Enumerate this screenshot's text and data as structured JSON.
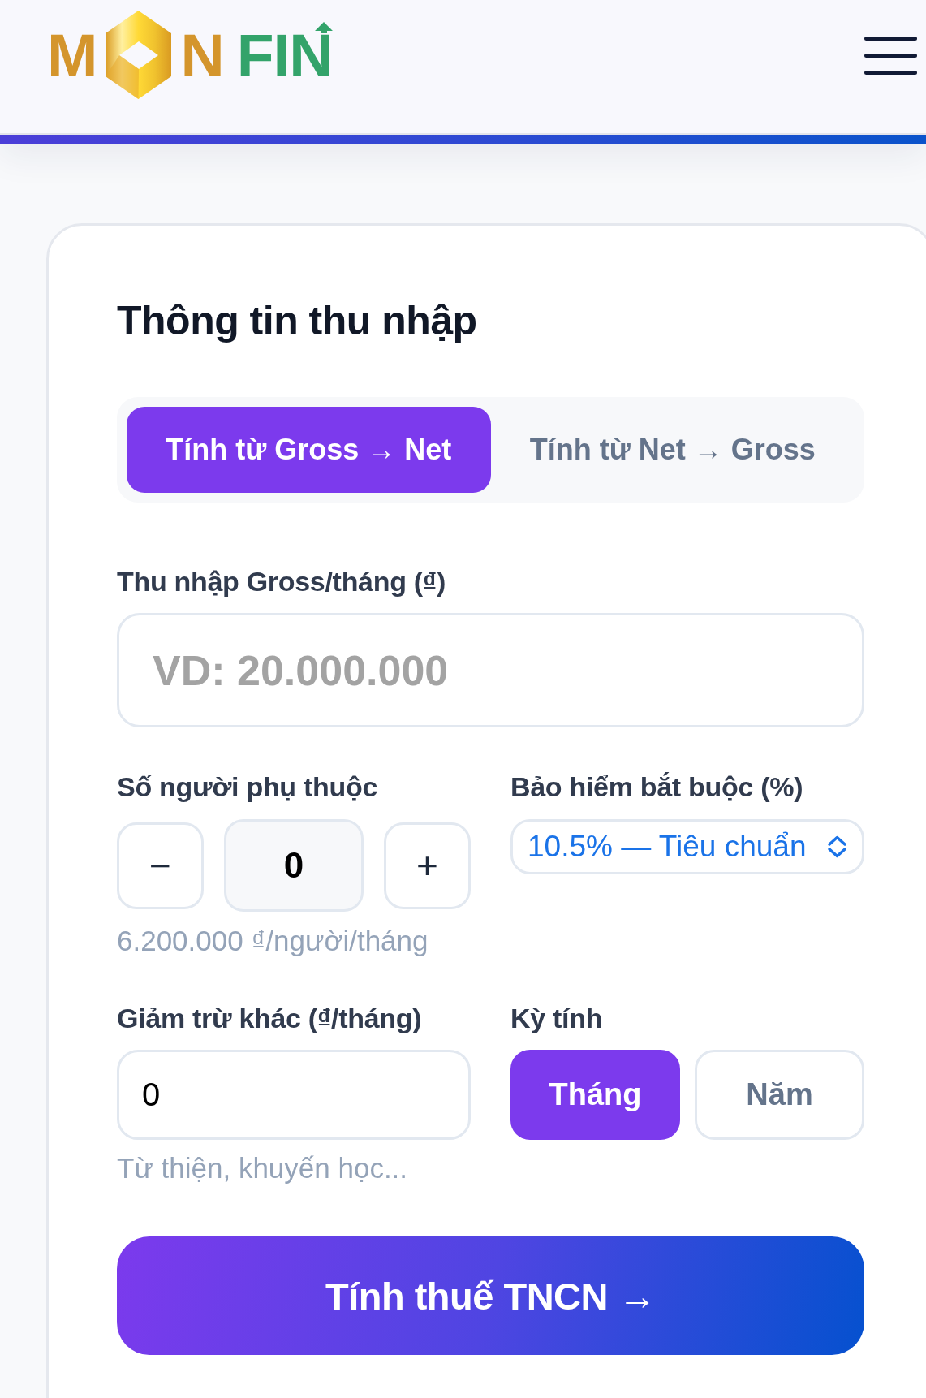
{
  "header": {
    "logo": {
      "text_before_icon": "M",
      "text_after_icon": "N",
      "accent_text": "FIN"
    }
  },
  "card": {
    "title": "Thông tin thu nhập",
    "mode_tabs": [
      {
        "label": "Tính từ Gross → Net",
        "selected": true
      },
      {
        "label": "Tính từ Net → Gross",
        "selected": false
      }
    ],
    "gross_income": {
      "label": "Thu nhập Gross/tháng (₫)",
      "placeholder": "VD: 20.000.000"
    },
    "dependents": {
      "label": "Số người phụ thuộc",
      "decrement": "−",
      "value": "0",
      "increment": "+",
      "hint": "6.200.000 ₫/người/tháng"
    },
    "insurance": {
      "label": "Bảo hiểm bắt buộc (%)",
      "value": "10.5% — Tiêu chuẩn"
    },
    "other_deductions": {
      "label": "Giảm trừ khác (₫/tháng)",
      "value": "0",
      "hint": "Từ thiện, khuyến học..."
    },
    "period": {
      "label": "Kỳ tính",
      "options": [
        {
          "label": "Tháng",
          "selected": true
        },
        {
          "label": "Năm",
          "selected": false
        }
      ]
    },
    "submit": {
      "label": "Tính thuế TNCN →"
    }
  }
}
